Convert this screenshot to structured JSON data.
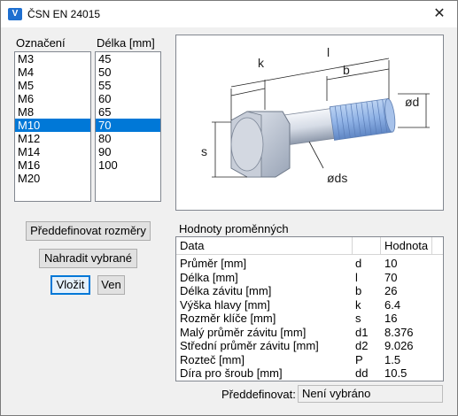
{
  "window": {
    "title": "ČSN EN 24015",
    "icon_letter": "V",
    "close_glyph": "✕"
  },
  "designation": {
    "label": "Označení",
    "items": [
      "M3",
      "M4",
      "M5",
      "M6",
      "M8",
      "M10",
      "M12",
      "M14",
      "M16",
      "M20"
    ],
    "selected": "M10"
  },
  "length": {
    "label": "Délka [mm]",
    "items": [
      "45",
      "50",
      "55",
      "60",
      "65",
      "70",
      "80",
      "90",
      "100"
    ],
    "selected": "70"
  },
  "buttons": {
    "predefine": "Předdefinovat rozměry",
    "replace": "Nahradit vybrané",
    "insert": "Vložit",
    "exit": "Ven"
  },
  "drawing": {
    "dim_l": "l",
    "dim_k": "k",
    "dim_b": "b",
    "dim_s": "s",
    "dim_d": "ød",
    "dim_ds": "øds"
  },
  "variables": {
    "label": "Hodnoty proměnných",
    "header": {
      "data": "Data",
      "symbol": "",
      "value": "Hodnota"
    },
    "rows": [
      {
        "name": "Průměr [mm]",
        "symbol": "d",
        "value": "10"
      },
      {
        "name": "Délka [mm]",
        "symbol": "l",
        "value": "70"
      },
      {
        "name": "Délka závitu [mm]",
        "symbol": "b",
        "value": "26"
      },
      {
        "name": "Výška hlavy [mm]",
        "symbol": "k",
        "value": "6.4"
      },
      {
        "name": "Rozměr klíče [mm]",
        "symbol": "s",
        "value": "16"
      },
      {
        "name": "Malý průměr závitu [mm]",
        "symbol": "d1",
        "value": "8.376"
      },
      {
        "name": "Střední průměr závitu [mm]",
        "symbol": "d2",
        "value": "9.026"
      },
      {
        "name": "Rozteč [mm]",
        "symbol": "P",
        "value": "1.5"
      },
      {
        "name": "Díra pro šroub [mm]",
        "symbol": "dd",
        "value": "10.5"
      }
    ]
  },
  "predefined": {
    "label": "Předdefinovat:",
    "value": "Není vybráno"
  }
}
